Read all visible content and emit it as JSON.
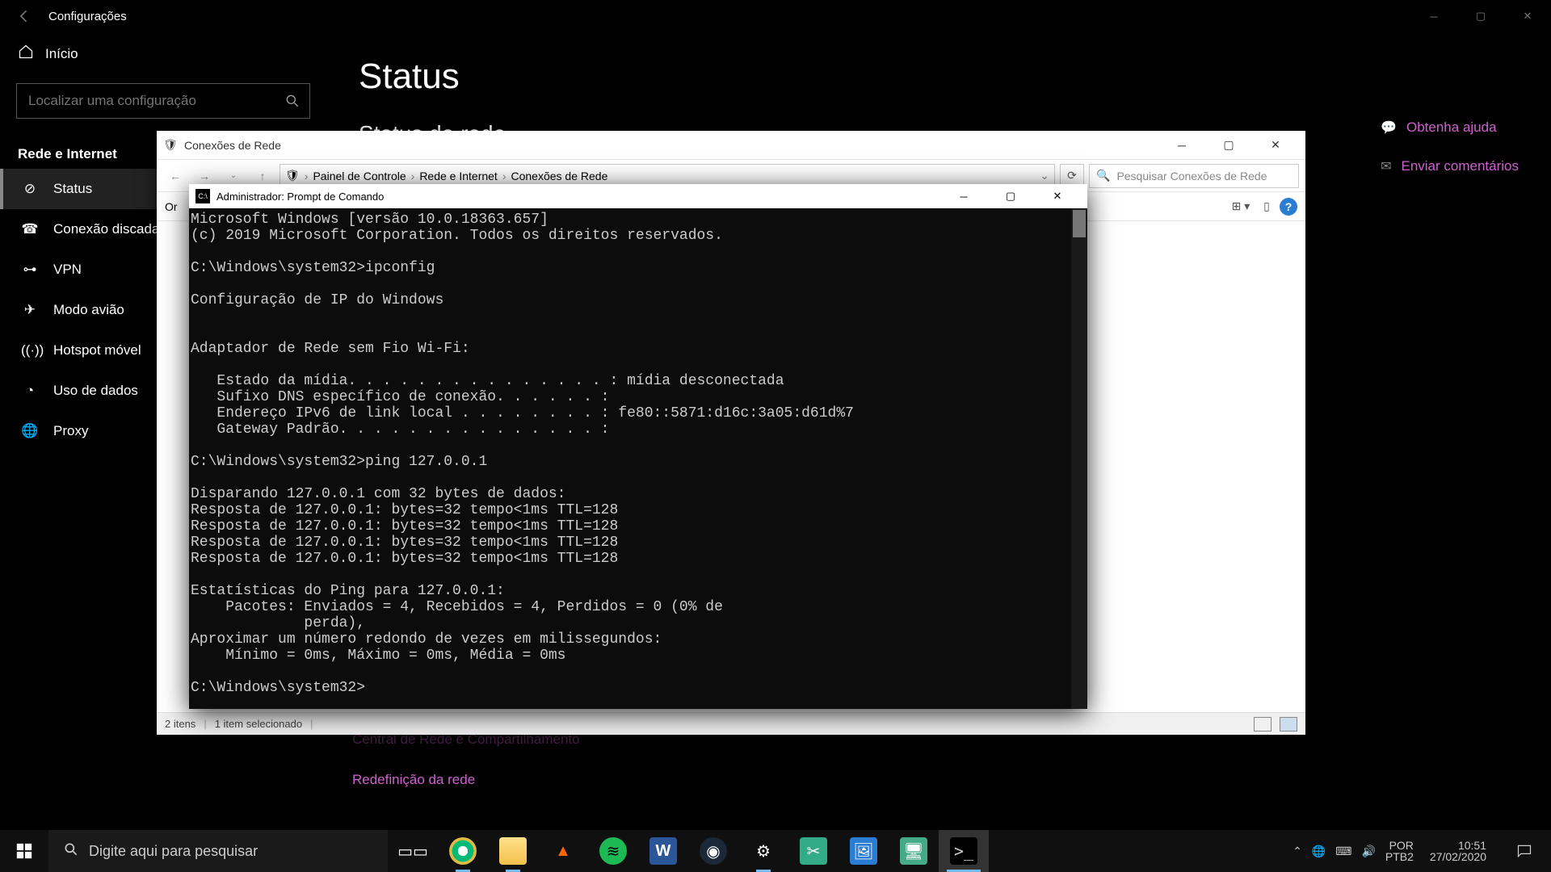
{
  "settings": {
    "app_title": "Configurações",
    "home_label": "Início",
    "search_placeholder": "Localizar uma configuração",
    "section": "Rede e Internet",
    "items": [
      {
        "label": "Status",
        "active": true
      },
      {
        "label": "Conexão discada"
      },
      {
        "label": "VPN"
      },
      {
        "label": "Modo avião"
      },
      {
        "label": "Hotspot móvel"
      },
      {
        "label": "Uso de dados"
      },
      {
        "label": "Proxy"
      }
    ],
    "page_title": "Status",
    "subhead": "Status da rede",
    "help_link": "Obtenha ajuda",
    "feedback_link": "Enviar comentários",
    "center_link": "Central de Rede e Compartilhamento",
    "reset_link": "Redefinição da rede"
  },
  "explorer": {
    "title": "Conexões de Rede",
    "breadcrumbs": [
      "Painel de Controle",
      "Rede e Internet",
      "Conexões de Rede"
    ],
    "search_placeholder": "Pesquisar Conexões de Rede",
    "toolbar_left": "Or",
    "status_items": "2 itens",
    "status_selected": "1 item selecionado"
  },
  "cmd": {
    "title": "Administrador: Prompt de Comando",
    "lines": [
      "Microsoft Windows [versão 10.0.18363.657]",
      "(c) 2019 Microsoft Corporation. Todos os direitos reservados.",
      "",
      "C:\\Windows\\system32>ipconfig",
      "",
      "Configuração de IP do Windows",
      "",
      "",
      "Adaptador de Rede sem Fio Wi-Fi:",
      "",
      "   Estado da mídia. . . . . . . . . . . . . . . : mídia desconectada",
      "   Sufixo DNS específico de conexão. . . . . . :",
      "   Endereço IPv6 de link local . . . . . . . . : fe80::5871:d16c:3a05:d61d%7",
      "   Gateway Padrão. . . . . . . . . . . . . . . :",
      "",
      "C:\\Windows\\system32>ping 127.0.0.1",
      "",
      "Disparando 127.0.0.1 com 32 bytes de dados:",
      "Resposta de 127.0.0.1: bytes=32 tempo<1ms TTL=128",
      "Resposta de 127.0.0.1: bytes=32 tempo<1ms TTL=128",
      "Resposta de 127.0.0.1: bytes=32 tempo<1ms TTL=128",
      "Resposta de 127.0.0.1: bytes=32 tempo<1ms TTL=128",
      "",
      "Estatísticas do Ping para 127.0.0.1:",
      "    Pacotes: Enviados = 4, Recebidos = 4, Perdidos = 0 (0% de",
      "             perda),",
      "Aproximar um número redondo de vezes em milissegundos:",
      "    Mínimo = 0ms, Máximo = 0ms, Média = 0ms",
      "",
      "C:\\Windows\\system32>"
    ]
  },
  "taskbar": {
    "search_placeholder": "Digite aqui para pesquisar",
    "apps": [
      "task-view",
      "chrome",
      "file-explorer",
      "vlc",
      "spotify",
      "word",
      "steam",
      "settings",
      "snip",
      "photos",
      "remote",
      "cmd"
    ],
    "lang1": "POR",
    "lang2": "PTB2",
    "time": "10:51",
    "date": "27/02/2020"
  }
}
